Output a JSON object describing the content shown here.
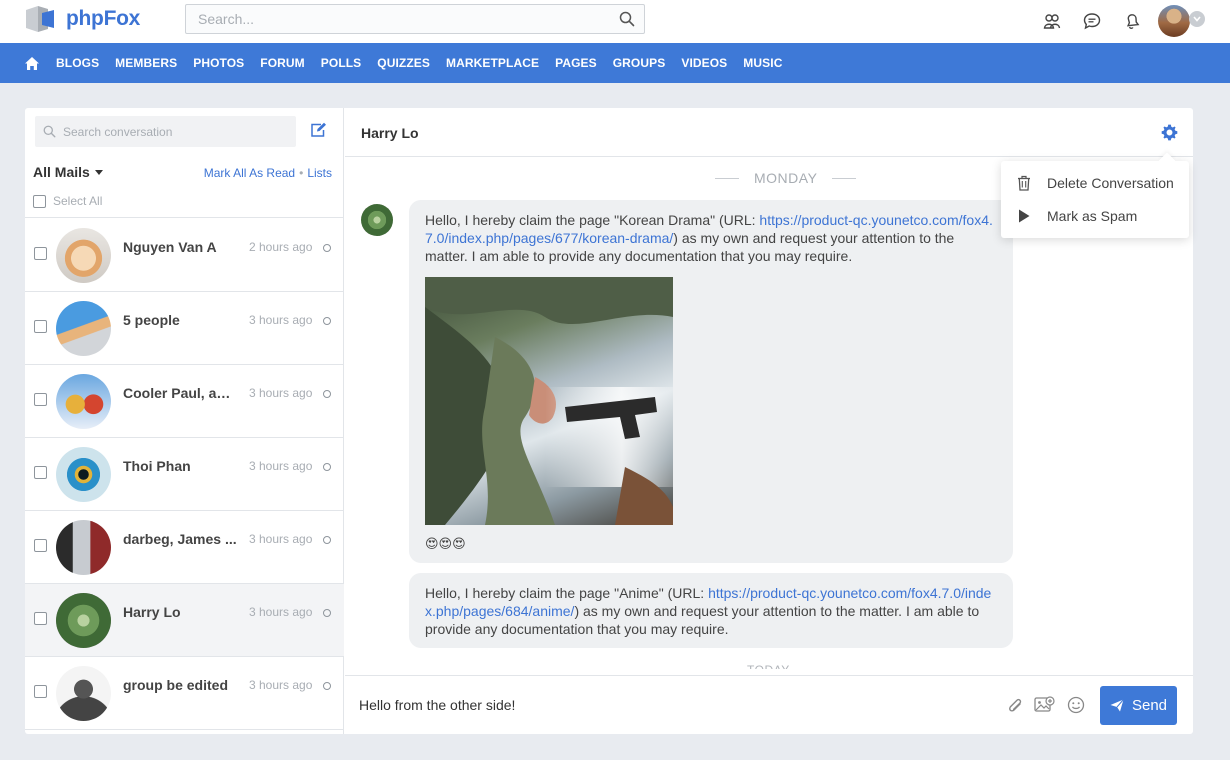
{
  "header": {
    "logo_text": "phpFox",
    "search_placeholder": "Search..."
  },
  "nav": {
    "items": [
      "BLOGS",
      "MEMBERS",
      "PHOTOS",
      "FORUM",
      "POLLS",
      "QUIZZES",
      "MARKETPLACE",
      "PAGES",
      "GROUPS",
      "VIDEOS",
      "MUSIC"
    ]
  },
  "sidebar": {
    "search_placeholder": "Search conversation",
    "filter_label": "All Mails",
    "mark_all_read": "Mark All As Read",
    "separator": "•",
    "lists": "Lists",
    "select_all": "Select All",
    "conversations": [
      {
        "name": "Nguyen Van A",
        "time": "2 hours ago"
      },
      {
        "name": "5 people",
        "time": "3 hours ago"
      },
      {
        "name": "Cooler Paul, am...",
        "time": "3 hours ago"
      },
      {
        "name": "Thoi Phan",
        "time": "3 hours ago"
      },
      {
        "name": "darbeg, James ...",
        "time": "3 hours ago"
      },
      {
        "name": "Harry Lo",
        "time": "3 hours ago"
      },
      {
        "name": "group be edited",
        "time": "3 hours ago"
      }
    ]
  },
  "chat": {
    "title": "Harry Lo",
    "day_label": "MONDAY",
    "today_label": "TODAY",
    "messages": [
      {
        "text_before": "Hello, I hereby claim the page \"Korean Drama\" (URL: ",
        "link": "https://product-qc.younetco.com/fox4.7.0/index.php/pages/677/korean-drama/",
        "text_after": ") as my own and request your attention to the matter. I am able to provide any documentation that you may require.",
        "emoji": "😍😍😍"
      },
      {
        "text_before": "Hello, I hereby claim the page \"Anime\" (URL: ",
        "link": "https://product-qc.younetco.com/fox4.7.0/index.php/pages/684/anime/",
        "text_after": ") as my own and request your attention to the matter. I am able to provide any documentation that you may require."
      }
    ],
    "composer_value": "Hello from the other side!",
    "send_label": "Send"
  },
  "dropdown": {
    "delete": "Delete Conversation",
    "spam": "Mark as Spam"
  },
  "colors": {
    "accent": "#3e79d7",
    "link": "#3d74d4"
  }
}
